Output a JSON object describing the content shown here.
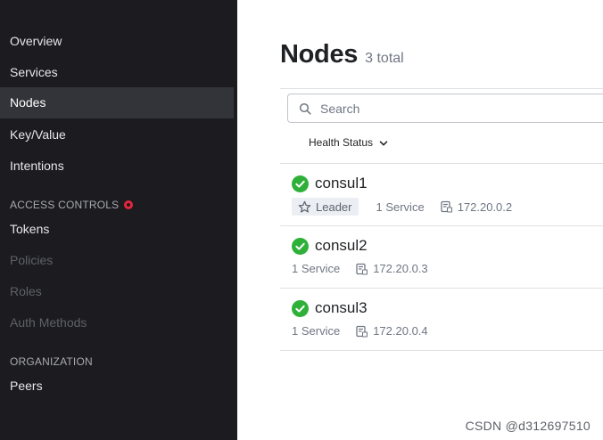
{
  "sidebar": {
    "items": [
      {
        "label": "Overview"
      },
      {
        "label": "Services"
      },
      {
        "label": "Nodes"
      },
      {
        "label": "Key/Value"
      },
      {
        "label": "Intentions"
      }
    ],
    "access_controls": {
      "heading": "ACCESS CONTROLS",
      "items": [
        {
          "label": "Tokens"
        },
        {
          "label": "Policies"
        },
        {
          "label": "Roles"
        },
        {
          "label": "Auth Methods"
        }
      ]
    },
    "organization": {
      "heading": "ORGANIZATION",
      "items": [
        {
          "label": "Peers"
        }
      ]
    }
  },
  "main": {
    "title": "Nodes",
    "total": "3 total",
    "search": {
      "placeholder": "Search",
      "value": ""
    },
    "filter_label": "Health Status",
    "nodes": [
      {
        "name": "consul1",
        "leader": "Leader",
        "services": "1 Service",
        "address": "172.20.0.2",
        "status": "passing"
      },
      {
        "name": "consul2",
        "services": "1 Service",
        "address": "172.20.0.3",
        "status": "passing"
      },
      {
        "name": "consul3",
        "services": "1 Service",
        "address": "172.20.0.4",
        "status": "passing"
      }
    ]
  },
  "watermark": "CSDN @d312697510",
  "colors": {
    "sidebar_bg": "#1b1b20",
    "sidebar_active": "#33343a",
    "passing": "#2eb039",
    "acl_dot": "#e5263c"
  }
}
